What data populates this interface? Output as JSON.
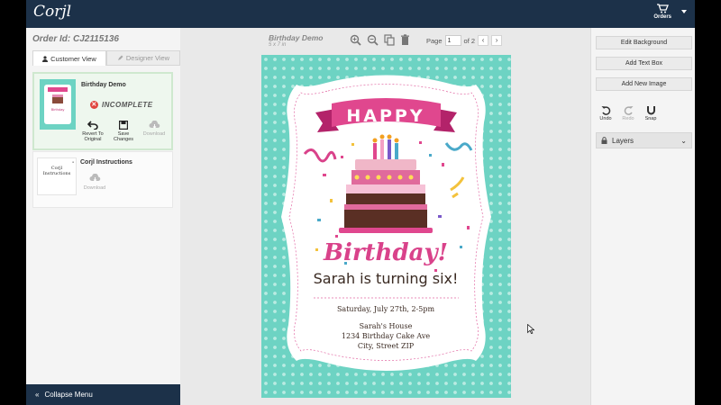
{
  "app": {
    "logo": "Corjl",
    "orders_label": "Orders"
  },
  "order": {
    "id_label": "Order Id: CJ2115136"
  },
  "tabs": [
    {
      "label": "Customer View"
    },
    {
      "label": "Designer View"
    }
  ],
  "items": [
    {
      "title": "Birthday Demo",
      "status": "INCOMPLETE",
      "actions": {
        "revert": "Revert To Original",
        "save": "Save Changes",
        "download": "Download"
      },
      "thumb_text": "Birthday"
    },
    {
      "title": "Corjl Instructions",
      "thumb_text": "Corjl Instructions",
      "download": "Download"
    }
  ],
  "collapse_label": "Collapse Menu",
  "document": {
    "title": "Birthday Demo",
    "size": "5 x 7 in",
    "page_label": "Page",
    "page_value": "1",
    "page_of": "of 2"
  },
  "invite": {
    "banner": "HAPPY",
    "headline": "Birthday!",
    "subtitle": "Sarah is turning six!",
    "date": "Saturday, July 27th, 2-5pm",
    "venue": "Sarah's House",
    "street": "1234 Birthday Cake Ave",
    "city": "City, Street ZIP"
  },
  "right_panel": {
    "edit_background": "Edit Background",
    "add_text_box": "Add Text Box",
    "add_new_image": "Add New Image",
    "undo": "Undo",
    "redo": "Redo",
    "snap": "Snap",
    "layers": "Layers"
  },
  "colors": {
    "topbar": "#1c3149",
    "mint": "#6dd3c3",
    "pink": "#e0478e",
    "brown": "#5a2f24"
  }
}
